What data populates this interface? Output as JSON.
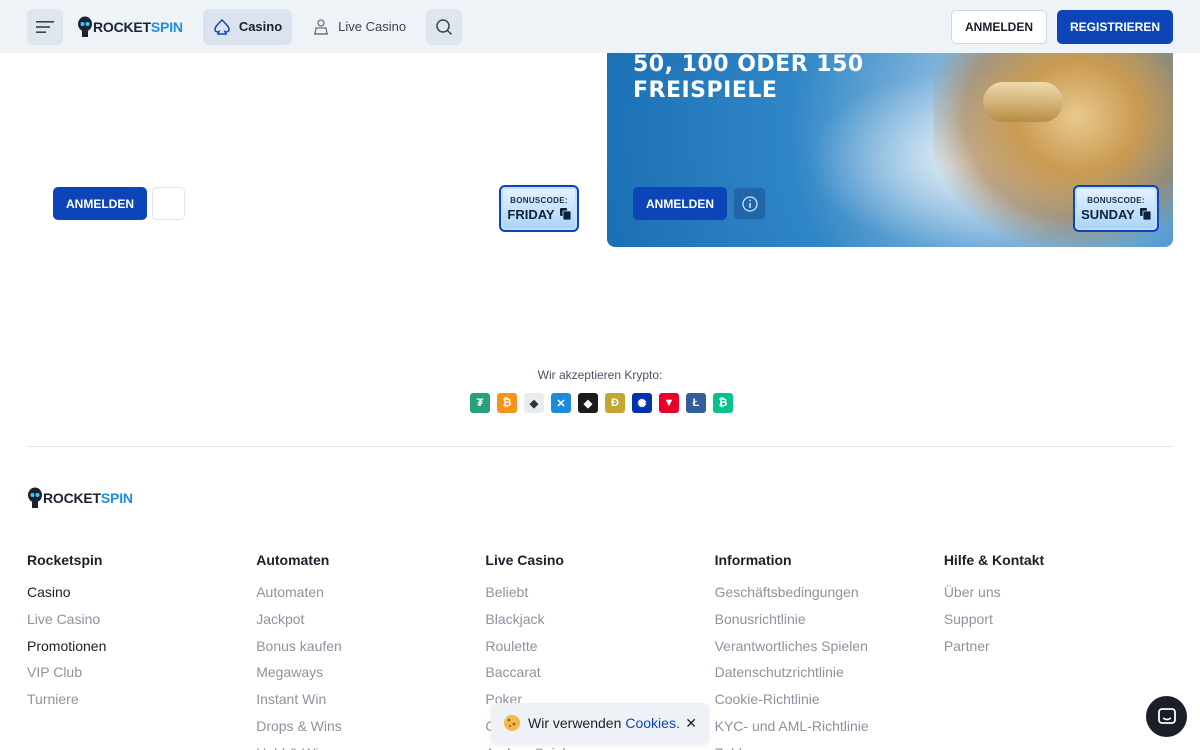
{
  "header": {
    "logo_rocket": "ROCKET",
    "logo_spin": "SPIN",
    "nav": {
      "casino": "Casino",
      "live_casino": "Live Casino"
    },
    "login_label": "ANMELDEN",
    "register_label": "REGISTRIEREN"
  },
  "promo_left": {
    "login_label": "ANMELDEN",
    "bonus_label": "BONUSCODE:",
    "bonus_code": "FRIDAY"
  },
  "promo_right": {
    "title_line1": "50, 100 ODER 150",
    "title_line2": "FREISPIELE",
    "login_label": "ANMELDEN",
    "bonus_label": "BONUSCODE:",
    "bonus_code": "SUNDAY"
  },
  "crypto": {
    "label": "Wir akzeptieren Krypto:",
    "icons": [
      {
        "name": "tether-icon",
        "glyph": "₮",
        "color": "#26a17b"
      },
      {
        "name": "bitcoin-icon",
        "glyph": "₿",
        "color": "#f7931a"
      },
      {
        "name": "ethereum-icon",
        "glyph": "◆",
        "color": "#e9ecef"
      },
      {
        "name": "ripple-icon",
        "glyph": "✕",
        "color": "#1d8cd8"
      },
      {
        "name": "binance-icon",
        "glyph": "◆",
        "color": "#1b1b1b"
      },
      {
        "name": "dogecoin-icon",
        "glyph": "Ð",
        "color": "#c2a633"
      },
      {
        "name": "cardano-icon",
        "glyph": "✺",
        "color": "#0033ad"
      },
      {
        "name": "tron-icon",
        "glyph": "▼",
        "color": "#eb0029"
      },
      {
        "name": "litecoin-icon",
        "glyph": "Ł",
        "color": "#345d9d"
      },
      {
        "name": "bitcoin-cash-icon",
        "glyph": "₿",
        "color": "#0ac18e"
      }
    ]
  },
  "footer": {
    "logo_rocket": "ROCKET",
    "logo_spin": "SPIN",
    "columns": [
      {
        "title": "Rocketspin",
        "links": [
          "Casino",
          "Live Casino",
          "Promotionen",
          "VIP Club",
          "Turniere"
        ]
      },
      {
        "title": "Automaten",
        "links": [
          "Automaten",
          "Jackpot",
          "Bonus kaufen",
          "Megaways",
          "Instant Win",
          "Drops & Wins",
          "Hold & Win"
        ]
      },
      {
        "title": "Live Casino",
        "links": [
          "Beliebt",
          "Blackjack",
          "Roulette",
          "Baccarat",
          "Poker",
          "Game Shows",
          "Andere Spiele"
        ]
      },
      {
        "title": "Information",
        "links": [
          "Geschäftsbedingungen",
          "Bonusrichtlinie",
          "Verantwortliches Spielen",
          "Datenschutzrichtlinie",
          "Cookie-Richtlinie",
          "KYC- und AML-Richtlinie",
          "Zahlungen"
        ]
      },
      {
        "title": "Hilfe & Kontakt",
        "links": [
          "Über uns",
          "Support",
          "Partner"
        ]
      }
    ]
  },
  "cookie": {
    "text": "Wir verwenden",
    "link": "Cookies."
  },
  "colors": {
    "primary": "#0d45b8",
    "header_bg": "#eef3f8"
  }
}
